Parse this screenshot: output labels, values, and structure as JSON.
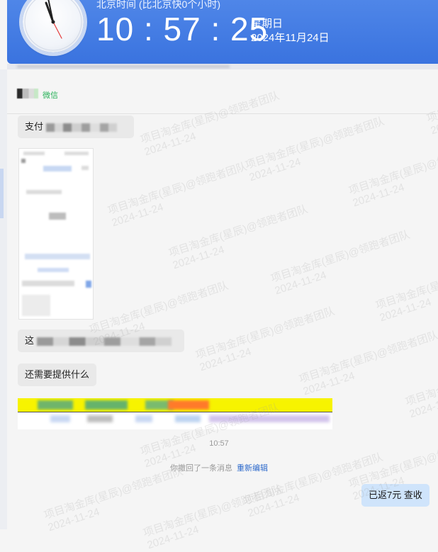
{
  "clock": {
    "zone_title": "北京时间 (比北京快0个小时)",
    "time": "10 : 57 : 25",
    "weekday": "星期日",
    "date": "2024年11月24日"
  },
  "chat": {
    "contact_suffix": "微信",
    "messages": {
      "m1_prefix": "支付",
      "m4_prefix": "这",
      "m5_text": "还需要提供什么",
      "time_separator": "10:57",
      "recall_text": "你撤回了一条消息",
      "recall_link": "重新编辑",
      "outgoing": "已返7元 查收"
    }
  },
  "watermark": {
    "line1": "项目淘金库(星辰)@领跑者团队",
    "line2": "2024-11-24"
  },
  "colors": {
    "clock_bg": "#3a73df",
    "outgoing_bubble": "#cfe4fb",
    "incoming_bubble": "#e9e9e9",
    "link": "#2f6bcc",
    "tag_green": "#2ab25a"
  }
}
